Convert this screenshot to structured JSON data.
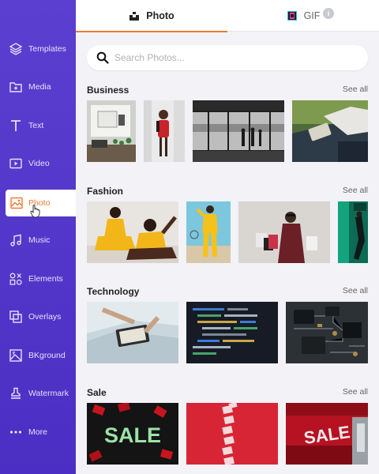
{
  "sidebar": {
    "items": [
      {
        "label": "Templates",
        "icon": "layers-icon"
      },
      {
        "label": "Media",
        "icon": "folder-plus-icon"
      },
      {
        "label": "Text",
        "icon": "text-icon"
      },
      {
        "label": "Video",
        "icon": "video-icon"
      },
      {
        "label": "Photo",
        "icon": "image-icon",
        "active": true
      },
      {
        "label": "Music",
        "icon": "music-icon"
      },
      {
        "label": "Elements",
        "icon": "shapes-icon"
      },
      {
        "label": "Overlays",
        "icon": "overlays-icon"
      },
      {
        "label": "BKground",
        "icon": "background-icon"
      },
      {
        "label": "Watermark",
        "icon": "stamp-icon"
      },
      {
        "label": "More",
        "icon": "more-dots-icon"
      }
    ]
  },
  "tabs": {
    "photo": "Photo",
    "gif": "GIF",
    "info": "i"
  },
  "search": {
    "placeholder": "Search Photos..."
  },
  "sections": [
    {
      "title": "Business",
      "see_all": "See all"
    },
    {
      "title": "Fashion",
      "see_all": "See all"
    },
    {
      "title": "Technology",
      "see_all": "See all"
    },
    {
      "title": "Sale",
      "see_all": "See all"
    }
  ],
  "thumbs": {
    "sale_text_1": "SALE",
    "sale_text_2": "SALE",
    "sale_tag": "SALE"
  },
  "colors": {
    "sidebar": "#5b3fd0",
    "accent": "#f07a32"
  }
}
